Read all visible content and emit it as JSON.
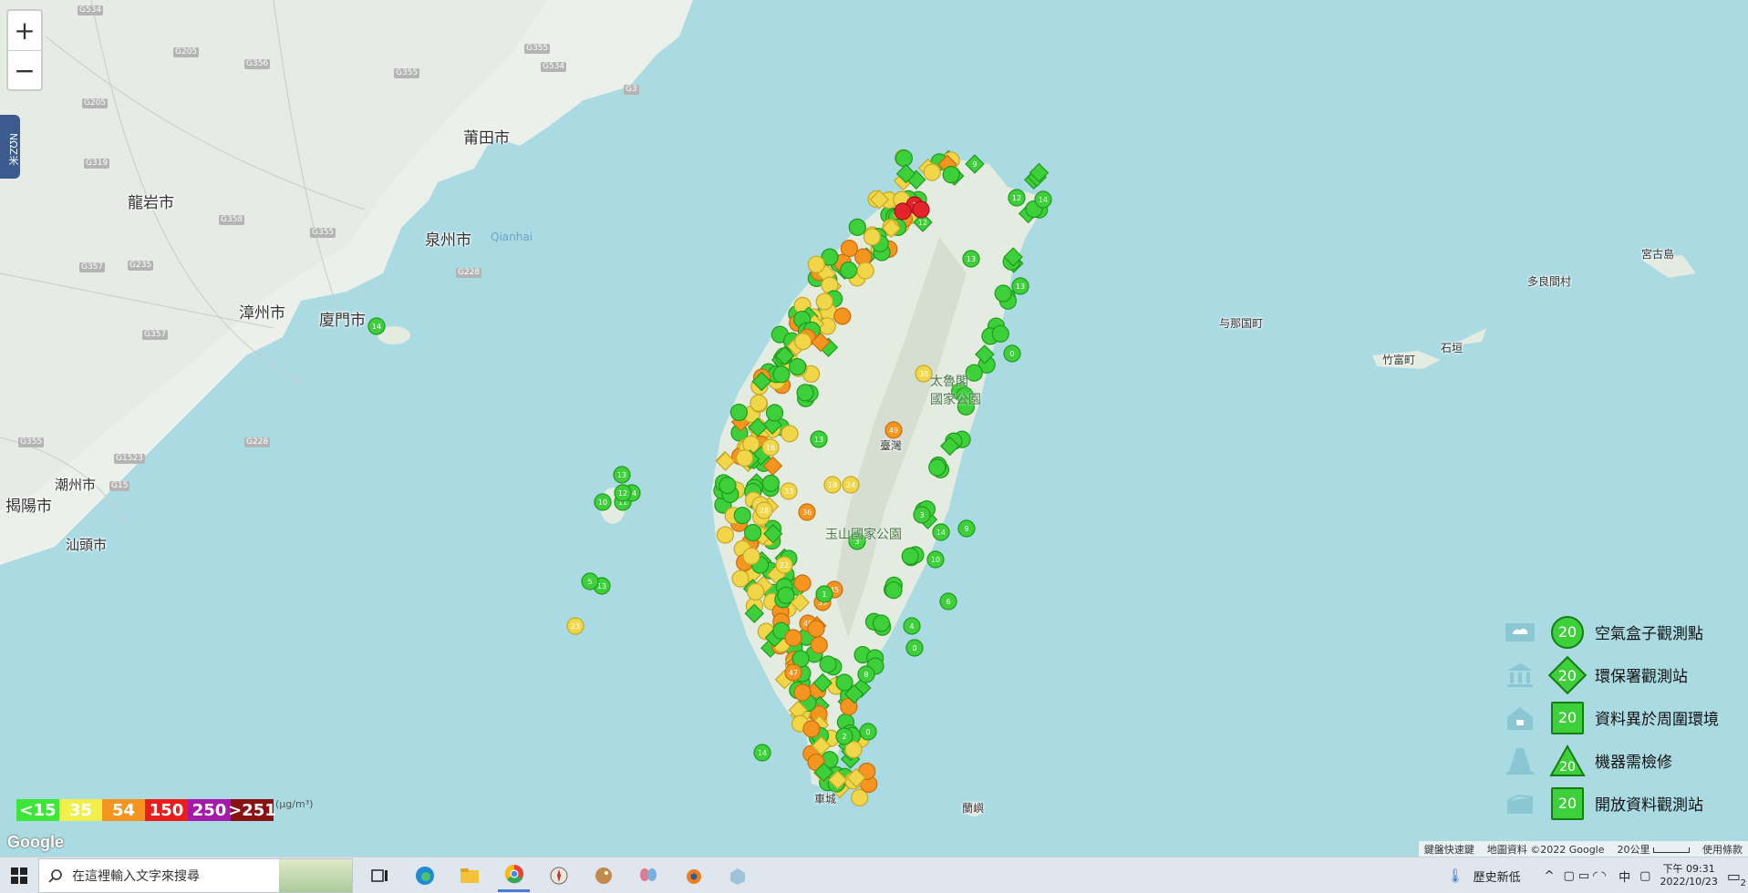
{
  "map": {
    "zoom_in_label": "+",
    "zoom_out_label": "−",
    "side_tab_label": "ΝΩΖ米",
    "place_labels": [
      {
        "id": "putian",
        "text": "莆田市"
      },
      {
        "id": "longyan",
        "text": "龍岩市"
      },
      {
        "id": "quanzhou",
        "text": "泉州市"
      },
      {
        "id": "qianhai",
        "text": "Qianhai"
      },
      {
        "id": "zhangzhou",
        "text": "漳州市"
      },
      {
        "id": "xiamen",
        "text": "廈門市"
      },
      {
        "id": "chaozhou",
        "text": "潮州市"
      },
      {
        "id": "jieyang",
        "text": "揭陽市"
      },
      {
        "id": "shantou",
        "text": "汕頭市"
      },
      {
        "id": "yonaguni",
        "text": "与那国町"
      },
      {
        "id": "taketomi",
        "text": "竹富町"
      },
      {
        "id": "ishigaki",
        "text": "石垣"
      },
      {
        "id": "tarama",
        "text": "多良間村"
      },
      {
        "id": "miyako",
        "text": "宮古島"
      },
      {
        "id": "taroko",
        "text": "太魯閣\n國家公園"
      },
      {
        "id": "yushan",
        "text": "玉山國家公園"
      },
      {
        "id": "taiwan",
        "text": "臺灣"
      },
      {
        "id": "lanyu",
        "text": "蘭嶼"
      },
      {
        "id": "hengchun",
        "text": "車城"
      }
    ],
    "road_labels": [
      "G534",
      "G205",
      "G355",
      "G356",
      "G534",
      "G3",
      "G319",
      "G205",
      "G358",
      "G355",
      "G357",
      "G235",
      "G228",
      "G357",
      "G355",
      "G1523",
      "G228",
      "G15",
      "G355"
    ]
  },
  "aqi_scale": {
    "unit": "(μg/m³)",
    "levels": [
      {
        "label": "<15",
        "color": "#3ee63a"
      },
      {
        "label": "35",
        "color": "#f2ee4a"
      },
      {
        "label": "54",
        "color": "#f5951f"
      },
      {
        "label": "150",
        "color": "#ec1c1c"
      },
      {
        "label": "250",
        "color": "#a31aa8"
      },
      {
        "label": ">251",
        "color": "#8a1212"
      }
    ]
  },
  "legend": {
    "marker_value": "20",
    "items": [
      {
        "label": "空氣盒子觀測點",
        "icon": "cloud-box-icon",
        "shape": "circle"
      },
      {
        "label": "環保署觀測站",
        "icon": "government-building-icon",
        "shape": "diamond"
      },
      {
        "label": "資料異於周圍環境",
        "icon": "house-icon",
        "shape": "circle"
      },
      {
        "label": "機器需檢修",
        "icon": "traffic-cone-icon",
        "shape": "triangle"
      },
      {
        "label": "開放資料觀測站",
        "icon": "open-box-icon",
        "shape": "square"
      }
    ]
  },
  "attribution": {
    "shortcuts": "鍵盤快速鍵",
    "map_data": "地圖資料 ©2022 Google",
    "scale": "20公里",
    "terms": "使用條款",
    "logo": "Google"
  },
  "markers": {
    "colors": {
      "green": "#3ed03a",
      "yellow": "#f2d64a",
      "orange": "#f5951f",
      "red": "#e3242b"
    },
    "labeled": [
      {
        "v": "9",
        "c": "green",
        "s": "d"
      },
      {
        "v": "14",
        "c": "green",
        "s": "c"
      },
      {
        "v": "12",
        "c": "green",
        "s": "c"
      },
      {
        "v": "13",
        "c": "green",
        "s": "c"
      },
      {
        "v": "13",
        "c": "green",
        "s": "c"
      },
      {
        "v": "5",
        "c": "green",
        "s": "c"
      },
      {
        "v": "23",
        "c": "yellow",
        "s": "c"
      },
      {
        "v": "30",
        "c": "yellow",
        "s": "c"
      },
      {
        "v": "49",
        "c": "orange",
        "s": "c"
      },
      {
        "v": "45",
        "c": "orange",
        "s": "c"
      },
      {
        "v": "39",
        "c": "orange",
        "s": "c"
      },
      {
        "v": "48",
        "c": "orange",
        "s": "c"
      },
      {
        "v": "47",
        "c": "orange",
        "s": "c"
      },
      {
        "v": "36",
        "c": "orange",
        "s": "c"
      },
      {
        "v": "24",
        "c": "yellow",
        "s": "c"
      },
      {
        "v": "19",
        "c": "yellow",
        "s": "c"
      },
      {
        "v": "14",
        "c": "green",
        "s": "c"
      },
      {
        "v": "2",
        "c": "green",
        "s": "c"
      },
      {
        "v": "8",
        "c": "green",
        "s": "c"
      },
      {
        "v": "0",
        "c": "green",
        "s": "c"
      },
      {
        "v": "13",
        "c": "green",
        "s": "c"
      },
      {
        "v": "11",
        "c": "green",
        "s": "c"
      },
      {
        "v": "10",
        "c": "green",
        "s": "c"
      },
      {
        "v": "14",
        "c": "green",
        "s": "c"
      },
      {
        "v": "12",
        "c": "green",
        "s": "c"
      },
      {
        "v": "14",
        "c": "green",
        "s": "c"
      },
      {
        "v": "12",
        "c": "green",
        "s": "d"
      },
      {
        "v": "13",
        "c": "green",
        "s": "c"
      },
      {
        "v": "0",
        "c": "green",
        "s": "c"
      },
      {
        "v": "9",
        "c": "green",
        "s": "c"
      },
      {
        "v": "6",
        "c": "green",
        "s": "c"
      },
      {
        "v": "14",
        "c": "green",
        "s": "c"
      },
      {
        "v": "16",
        "c": "yellow",
        "s": "c"
      },
      {
        "v": "13",
        "c": "green",
        "s": "c"
      },
      {
        "v": "1",
        "c": "green",
        "s": "c"
      },
      {
        "v": "3",
        "c": "green",
        "s": "c"
      },
      {
        "v": "0",
        "c": "green",
        "s": "c"
      },
      {
        "v": "4",
        "c": "green",
        "s": "c"
      },
      {
        "v": "10",
        "c": "green",
        "s": "c"
      },
      {
        "v": "3",
        "c": "green",
        "s": "c"
      },
      {
        "v": "21",
        "c": "yellow",
        "s": "c"
      },
      {
        "v": "33",
        "c": "yellow",
        "s": "c"
      },
      {
        "v": "28",
        "c": "yellow",
        "s": "c"
      },
      {
        "v": "22",
        "c": "yellow",
        "s": "c"
      },
      {
        "v": "1",
        "c": "red",
        "s": "c"
      }
    ]
  },
  "taskbar": {
    "search_placeholder": "在這裡輸入文字來搜尋",
    "weather": "歷史新低",
    "ime": "中",
    "time": "下午 09:31",
    "date": "2022/10/23",
    "notifications": "2",
    "apps": [
      "task-view",
      "edge",
      "file-explorer",
      "chrome",
      "app-compass",
      "app-bird",
      "app-butterfly",
      "blender",
      "app-box"
    ]
  }
}
